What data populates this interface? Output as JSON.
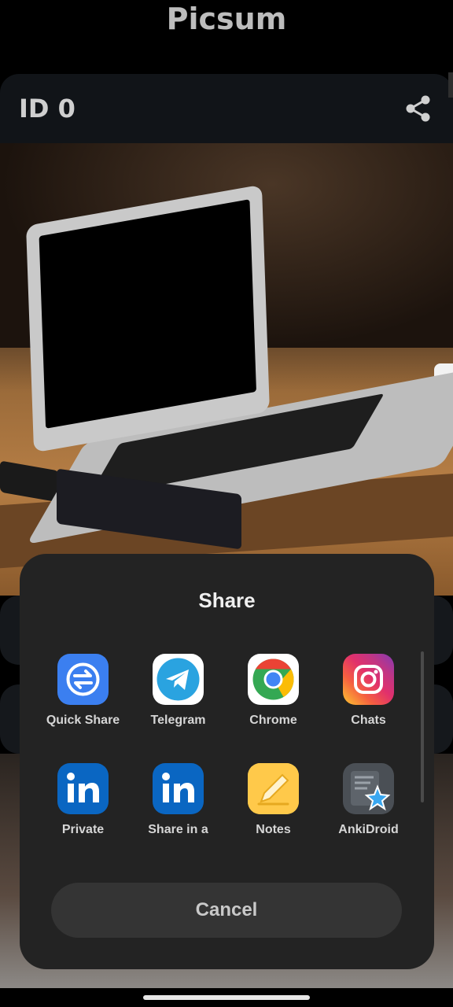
{
  "app": {
    "title": "Picsum"
  },
  "card": {
    "id_label": "ID 0"
  },
  "share_sheet": {
    "title": "Share",
    "apps": [
      {
        "label": "Quick Share",
        "icon": "quick-share-icon"
      },
      {
        "label": "Telegram",
        "icon": "telegram-icon"
      },
      {
        "label": "Chrome",
        "icon": "chrome-icon"
      },
      {
        "label": "Chats",
        "icon": "instagram-icon"
      },
      {
        "label": "Private",
        "icon": "linkedin-icon"
      },
      {
        "label": "Share in a",
        "icon": "linkedin-icon"
      },
      {
        "label": "Notes",
        "icon": "notes-icon"
      },
      {
        "label": "AnkiDroid",
        "icon": "ankidroid-icon"
      }
    ],
    "cancel_label": "Cancel"
  },
  "colors": {
    "background": "#000000",
    "sheet": "#232323",
    "cancel_button": "#343434",
    "quick_share": "#3b7ff0",
    "telegram": "#2aa3e0",
    "linkedin": "#0a66c2",
    "notes": "#ffc94a"
  }
}
